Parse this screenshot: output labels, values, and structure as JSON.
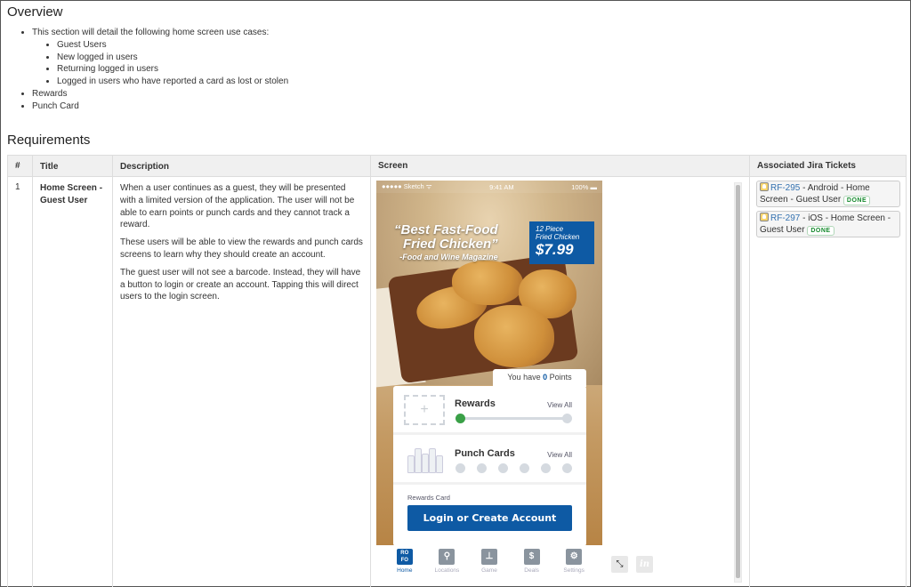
{
  "overview": {
    "title": "Overview",
    "intro": "This section will detail the following home screen use cases:",
    "use_cases": [
      "Guest Users",
      "New logged in users",
      "Returning logged in users",
      "Logged in users who have reported a card as lost or stolen"
    ],
    "other_items": [
      "Rewards",
      "Punch Card"
    ]
  },
  "requirements": {
    "title": "Requirements",
    "columns": [
      "#",
      "Title",
      "Description",
      "Screen",
      "Associated Jira Tickets"
    ],
    "rows": [
      {
        "num": "1",
        "title": "Home Screen - Guest User",
        "description": [
          "When a user continues as a guest, they will be presented with a limited version of the application. The user will not be able to earn points or punch cards and they cannot track a reward.",
          "These users will be able to view the rewards and punch cards screens to learn why they should create an account.",
          "The guest user will not see a barcode. Instead, they will have a button to login or create an account. Tapping this will direct users to the login screen."
        ],
        "tickets": [
          {
            "key": "RF-295",
            "summary": " - Android - Home Screen - Guest User ",
            "status": "DONE"
          },
          {
            "key": "RF-297",
            "summary": " - iOS - Home Screen - Guest User ",
            "status": "DONE"
          }
        ]
      }
    ]
  },
  "mockup": {
    "status_left": "●●●●● Sketch ᯤ",
    "status_time": "9:41 AM",
    "status_right": "100% ▬",
    "headline_1": "“Best Fast-Food",
    "headline_2": "Fried Chicken”",
    "headline_3": "-Food and Wine Magazine",
    "price_label_1": "12 Piece",
    "price_label_2": "Fried Chicken",
    "price": "$7.99",
    "points_prefix": "You have ",
    "points_value": "0",
    "points_suffix": " Points",
    "rewards_label": "Rewards",
    "rewards_view_all": "View All",
    "rewards_progress": 0,
    "punch_label": "Punch Cards",
    "punch_view_all": "View All",
    "punch_count": 6,
    "punches_filled": 0,
    "rewards_card_label": "Rewards Card",
    "login_button": "Login or Create Account",
    "tabs": [
      {
        "label": "Home",
        "icon": "RO FO"
      },
      {
        "label": "Locations",
        "icon": "⚲"
      },
      {
        "label": "Game",
        "icon": "⊥"
      },
      {
        "label": "Deals",
        "icon": "$"
      },
      {
        "label": "Settings",
        "icon": "⚙"
      }
    ],
    "active_tab": "Home",
    "minimize_icon": "⤡",
    "invision_icon": "in"
  },
  "colors": {
    "brand_blue": "#0e5aa4",
    "link_blue": "#3572b0",
    "done_green": "#14892c",
    "progress_green": "#3aa047"
  }
}
